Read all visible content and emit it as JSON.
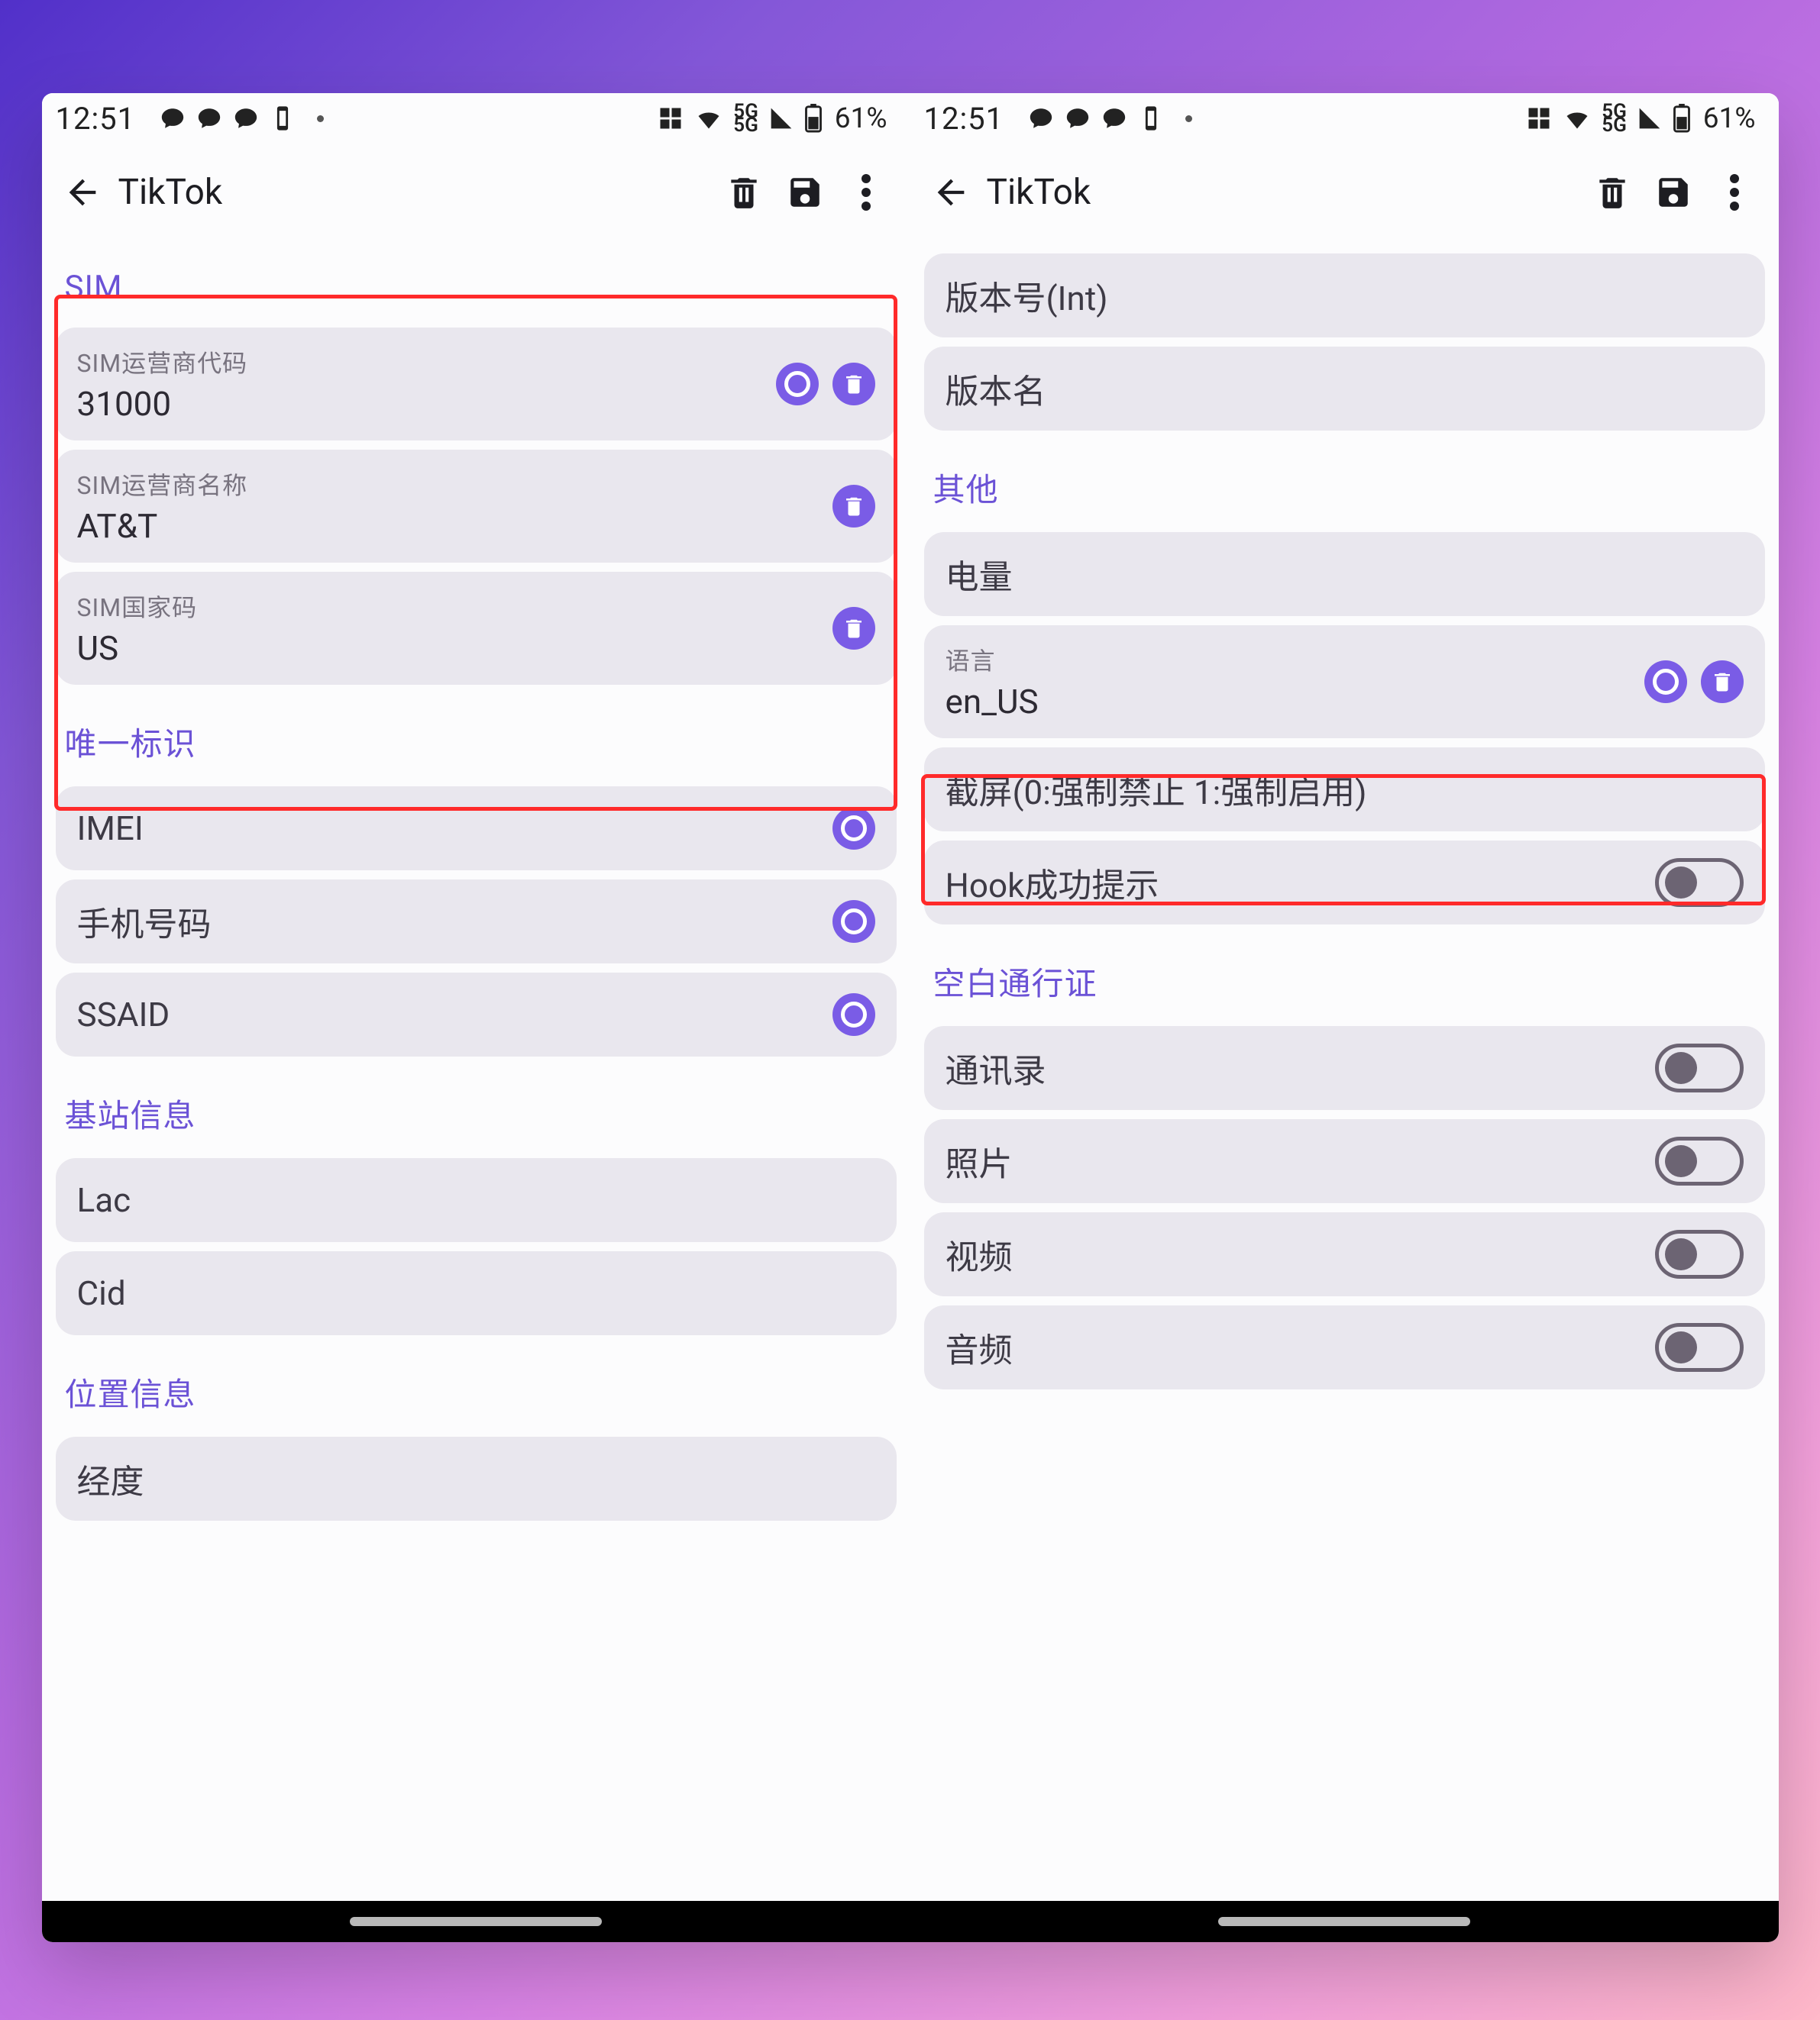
{
  "status": {
    "time": "12:51",
    "signal_label": "5G",
    "battery_pct": "61%"
  },
  "appbar": {
    "title": "TikTok"
  },
  "left_screen": {
    "sections": [
      {
        "title": "SIM",
        "items": [
          {
            "sublabel": "SIM运营商代码",
            "value": "31000",
            "has_radio": true,
            "has_trash": true
          },
          {
            "sublabel": "SIM运营商名称",
            "value": "AT&T",
            "has_radio": false,
            "has_trash": true
          },
          {
            "sublabel": "SIM国家码",
            "value": "US",
            "has_radio": false,
            "has_trash": true
          }
        ]
      },
      {
        "title": "唯一标识",
        "items": [
          {
            "label": "IMEI",
            "has_radio": true
          },
          {
            "label": "手机号码",
            "has_radio": true
          },
          {
            "label": "SSAID",
            "has_radio": true
          }
        ]
      },
      {
        "title": "基站信息",
        "items": [
          {
            "label": "Lac"
          },
          {
            "label": "Cid"
          }
        ]
      },
      {
        "title": "位置信息",
        "items": [
          {
            "label": "经度"
          }
        ]
      }
    ]
  },
  "right_screen": {
    "pre_items": [
      {
        "label": "版本号(Int)"
      },
      {
        "label": "版本名"
      }
    ],
    "sections": [
      {
        "title": "其他",
        "items": [
          {
            "label": "电量"
          },
          {
            "sublabel": "语言",
            "value": "en_US",
            "has_radio": true,
            "has_trash": true
          },
          {
            "label": "截屏(0:强制禁止 1:强制启用)"
          },
          {
            "label": "Hook成功提示",
            "toggle": false
          }
        ]
      },
      {
        "title": "空白通行证",
        "items": [
          {
            "label": "通讯录",
            "toggle": false
          },
          {
            "label": "照片",
            "toggle": false
          },
          {
            "label": "视频",
            "toggle": false
          },
          {
            "label": "音频",
            "toggle": false
          }
        ]
      }
    ]
  }
}
